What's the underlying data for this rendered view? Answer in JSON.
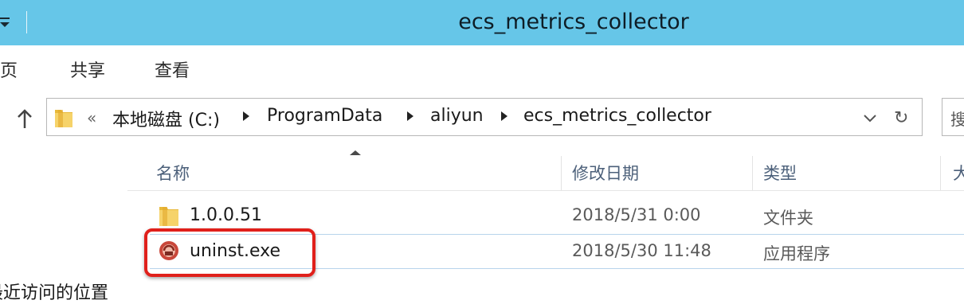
{
  "window": {
    "title": "ecs_metrics_collector"
  },
  "ribbon": {
    "tabs": [
      {
        "label": "主页"
      },
      {
        "label": "共享"
      },
      {
        "label": "查看"
      }
    ]
  },
  "address_bar": {
    "overflow_glyph": "«",
    "crumbs": [
      "本地磁盘 (C:)",
      "ProgramData",
      "aliyun",
      "ecs_metrics_collector"
    ],
    "refresh_glyph": "↻",
    "search_glyph": "搜"
  },
  "nav_pane": {
    "items": [
      {
        "label": "最近访问的位置"
      }
    ]
  },
  "file_list": {
    "columns": [
      "名称",
      "修改日期",
      "类型",
      "大小"
    ],
    "rows": [
      {
        "name": "1.0.0.51",
        "modified": "2018/5/31 0:00",
        "type": "文件夹",
        "icon": "folder-icon"
      },
      {
        "name": "uninst.exe",
        "modified": "2018/5/30 11:48",
        "type": "应用程序",
        "icon": "installer-icon"
      }
    ]
  },
  "colors": {
    "titlebar": "#66c6e8",
    "highlight": "#e0201b",
    "header_text": "#4c607a"
  }
}
